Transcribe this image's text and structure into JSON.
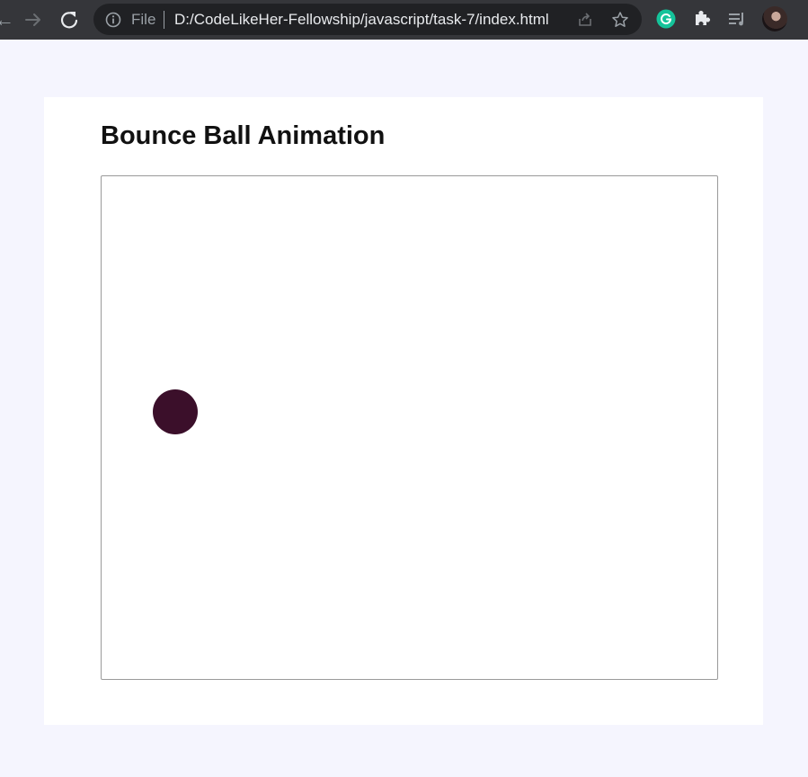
{
  "browser": {
    "back_glyph": "←",
    "scheme": "File",
    "url": "D:/CodeLikeHer-Fellowship/javascript/task-7/index.html",
    "icons": {
      "back": "arrow-left-icon",
      "forward": "arrow-right-icon",
      "reload": "reload-icon",
      "info": "info-icon",
      "share": "share-icon",
      "bookmark": "star-icon",
      "grammarly": "grammarly-icon",
      "extensions": "puzzle-icon",
      "media": "media-control-icon"
    },
    "colors": {
      "toolbar": "#35363a",
      "omnibox": "#202124",
      "grammarly": "#15c39a"
    }
  },
  "page": {
    "title": "Bounce Ball Animation",
    "ball_color": "#3b0f2a",
    "background": "#f5f5fe"
  }
}
